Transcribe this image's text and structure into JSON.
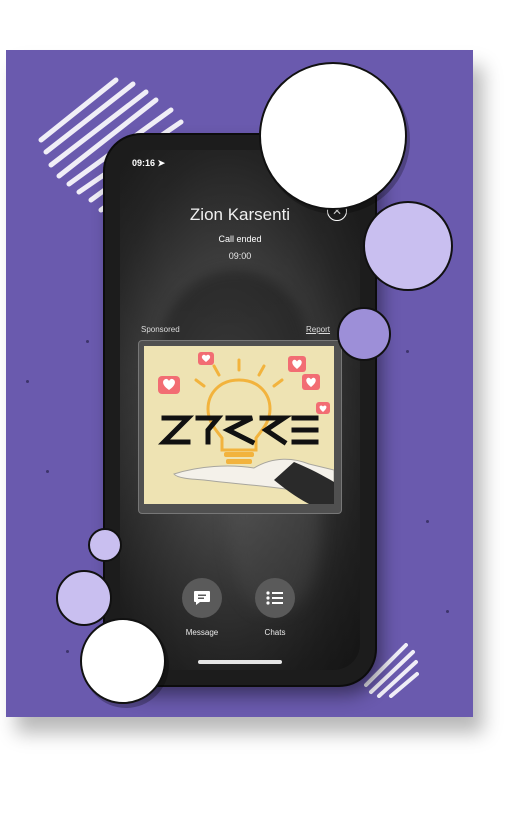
{
  "status_bar": {
    "time": "09:16"
  },
  "call": {
    "caller_name": "Zion Karsenti",
    "status": "Call ended",
    "duration": "09:00"
  },
  "ad": {
    "sponsored_label": "Sponsored",
    "report_label": "Report"
  },
  "actions": [
    {
      "label": "Message",
      "icon": "message-icon"
    },
    {
      "label": "Chats",
      "icon": "list-icon"
    }
  ],
  "colors": {
    "background": "#6a5aae",
    "bubble_lavender": "#c9bff0",
    "bubble_mid": "#9d8fd8",
    "ad_background": "#eee3b3",
    "heart_badge": "#f26d73",
    "bulb": "#f2b33d"
  }
}
